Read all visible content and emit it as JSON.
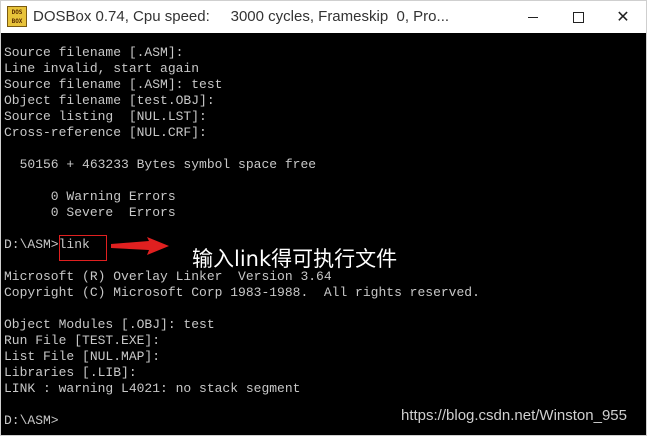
{
  "window": {
    "title": "DOSBox 0.74, Cpu speed:     3000 cycles, Frameskip  0, Pro...",
    "icon": "dosbox-app-icon",
    "icon_text": [
      "DOS",
      "BOX"
    ]
  },
  "title_buttons": {
    "minimize_icon": "minimize-icon",
    "maximize_icon": "maximize-icon",
    "close_icon": "close-icon",
    "close_glyph": "✕"
  },
  "console": {
    "lines": [
      "Source filename [.ASM]:",
      "Line invalid, start again",
      "Source filename [.ASM]: test",
      "Object filename [test.OBJ]:",
      "Source listing  [NUL.LST]:",
      "Cross-reference [NUL.CRF]:",
      "",
      "  50156 + 463233 Bytes symbol space free",
      "",
      "      0 Warning Errors",
      "      0 Severe  Errors",
      "",
      "D:\\ASM>link",
      "",
      "Microsoft (R) Overlay Linker  Version 3.64",
      "Copyright (C) Microsoft Corp 1983-1988.  All rights reserved.",
      "",
      "Object Modules [.OBJ]: test",
      "Run File [TEST.EXE]:",
      "List File [NUL.MAP]:",
      "Libraries [.LIB]:",
      "LINK : warning L4021: no stack segment",
      "",
      "D:\\ASM>"
    ]
  },
  "annotation": {
    "text": "输入link得可执行文件",
    "color": "#e02020"
  },
  "watermark": "https://blog.csdn.net/Winston_955"
}
